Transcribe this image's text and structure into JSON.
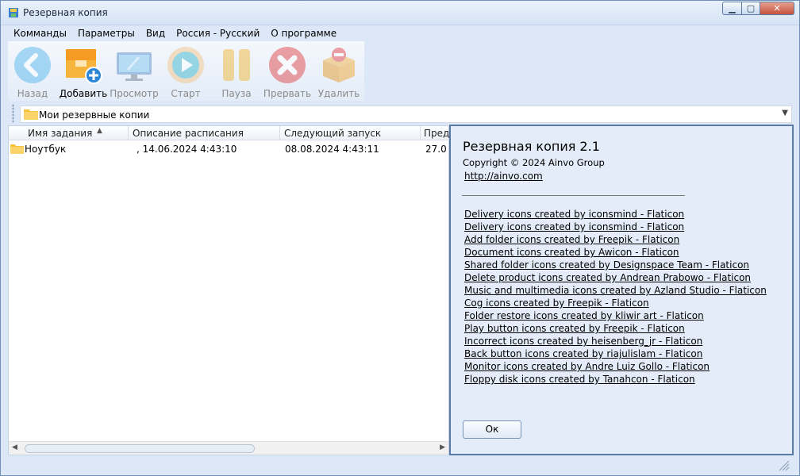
{
  "window": {
    "title": "Резервная копия"
  },
  "menu": [
    "Комманды",
    "Параметры",
    "Вид",
    "Россия - Русский",
    "О программе"
  ],
  "toolbar": {
    "back": "Назад",
    "add": "Добавить",
    "view": "Просмотр",
    "start": "Старт",
    "pause": "Пауза",
    "abort": "Прервать",
    "delete": "Удалить"
  },
  "address": {
    "path": "Мои резервные копии"
  },
  "list": {
    "columns": [
      "Имя задания",
      "Описание расписания",
      "Следующий запуск",
      "Пред"
    ],
    "rows": [
      {
        "name": "Ноутбук",
        "schedule": ",  14.06.2024 4:43:10",
        "next": "08.08.2024 4:43:11",
        "prev": "27.0"
      }
    ]
  },
  "about": {
    "title": "Резервная копия 2.1",
    "copyright": "Copyright © 2024 Ainvo Group",
    "url": "http://ainvo.com",
    "credits": [
      "Delivery icons created by iconsmind - Flaticon",
      "Delivery icons created by iconsmind - Flaticon",
      "Add folder icons created by Freepik - Flaticon",
      "Document icons created by Awicon - Flaticon",
      "Shared folder icons created by Designspace Team - Flaticon",
      "Delete product icons created by Andrean Prabowo - Flaticon",
      "Music and multimedia icons created by Azland Studio - Flaticon",
      "Cog icons created by Freepik - Flaticon",
      "Folder restore icons created by kliwir art - Flaticon",
      "Play button icons created by Freepik - Flaticon",
      "Incorrect icons created by heisenberg_jr - Flaticon",
      "Back button icons created by riajulislam - Flaticon",
      "Monitor icons created by Andre Luiz Gollo - Flaticon",
      "Floppy disk icons created by Tanahcon - Flaticon"
    ],
    "ok": "Ок"
  },
  "colors": {
    "back_icon": "#5ab8ee",
    "play_icon": "#3fb6cc",
    "pause_icon": "#f0b83a",
    "abort_icon": "#e0484a",
    "window_bg": "#dce8f7"
  }
}
